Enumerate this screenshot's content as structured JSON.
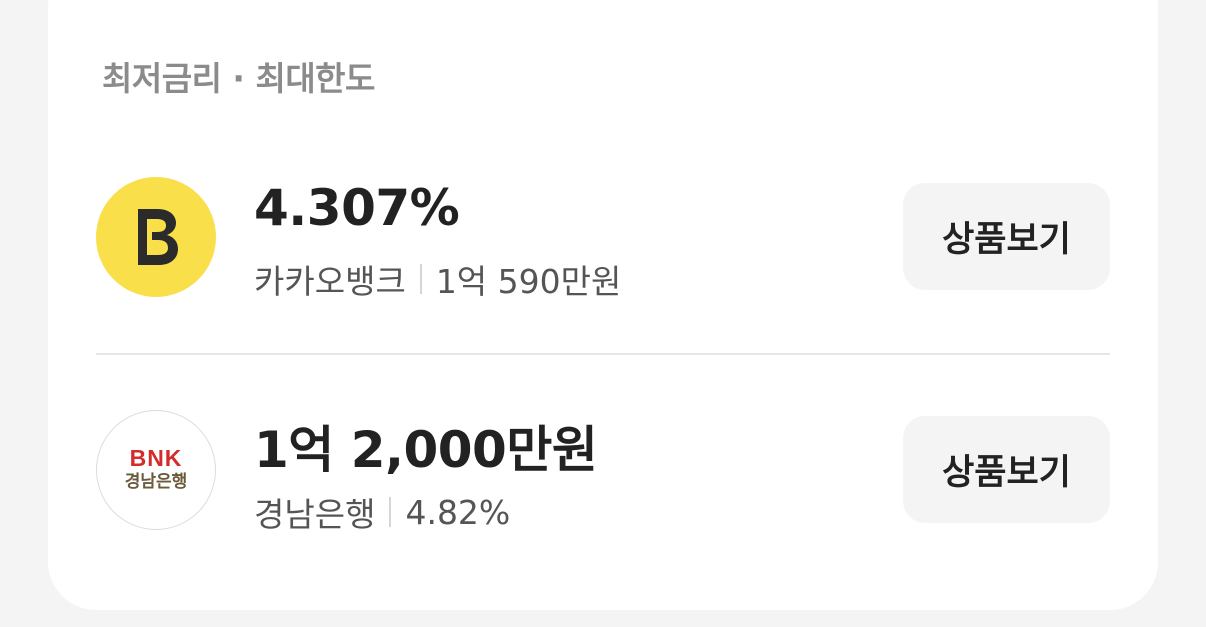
{
  "section": {
    "title": "최저금리 · 최대한도"
  },
  "products": [
    {
      "bank": "카카오뱅크",
      "logo_icon": "kakaobank-logo",
      "logo_color": "#f9e04b",
      "primary": "4.307%",
      "secondary_value": "1억 590만원",
      "button_label": "상품보기"
    },
    {
      "bank": "경남은행",
      "logo_icon": "bnk-logo",
      "logo_mark": "BNK",
      "logo_name": "경남은행",
      "logo_color": "#d32d2b",
      "primary": "1억 2,000만원",
      "secondary_value": "4.82%",
      "button_label": "상품보기"
    }
  ]
}
